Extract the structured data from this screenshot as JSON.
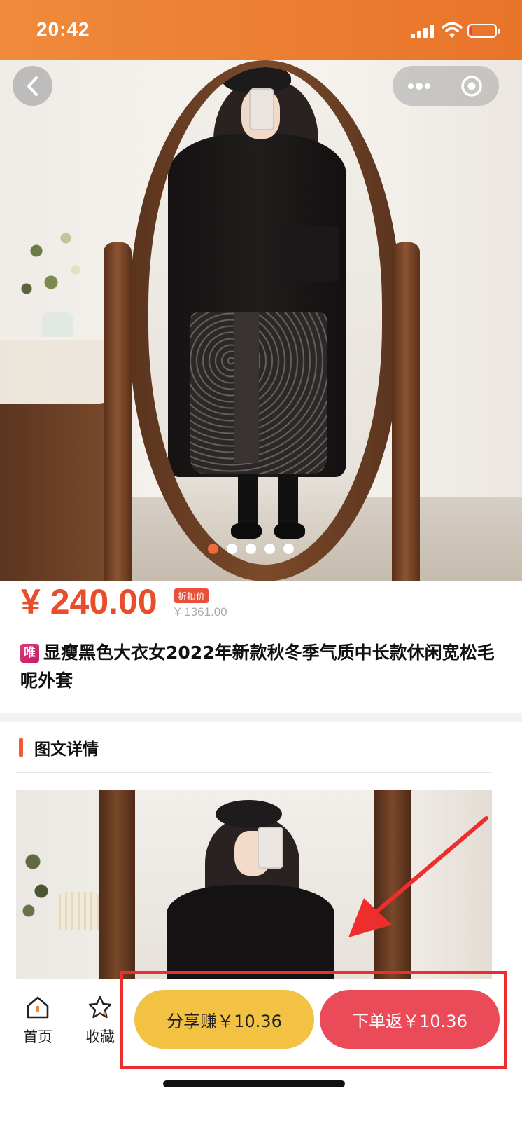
{
  "status_bar": {
    "time": "20:42",
    "background": "#e97c30",
    "icons": [
      "signal-icon",
      "wifi-icon",
      "battery-icon"
    ],
    "battery_level": 0.1
  },
  "header": {
    "back_icon": "chevron-left-icon",
    "capsule_icons": [
      "more-icon",
      "close-mini-program-icon"
    ]
  },
  "carousel": {
    "image_count": 5,
    "active_index": 0,
    "active_color": "#ee6a3a"
  },
  "product": {
    "price": "¥ 240.00",
    "discount_tag": "折扣价",
    "original_price": "¥ 1361.00",
    "platform_badge": "唯",
    "title": "显瘦黑色大衣女2022年新款秋冬季气质中长款休闲宽松毛呢外套",
    "price_color": "#e94e2c"
  },
  "details_section": {
    "title": "图文详情"
  },
  "bottom_bar": {
    "home_label": "首页",
    "favorite_label": "收藏",
    "share_button": "分享赚￥10.36",
    "order_button": "下单返￥10.36",
    "share_color": "#f4c243",
    "order_color": "#eb4a59"
  },
  "annotation": {
    "highlight_color": "#ee2d2d"
  }
}
